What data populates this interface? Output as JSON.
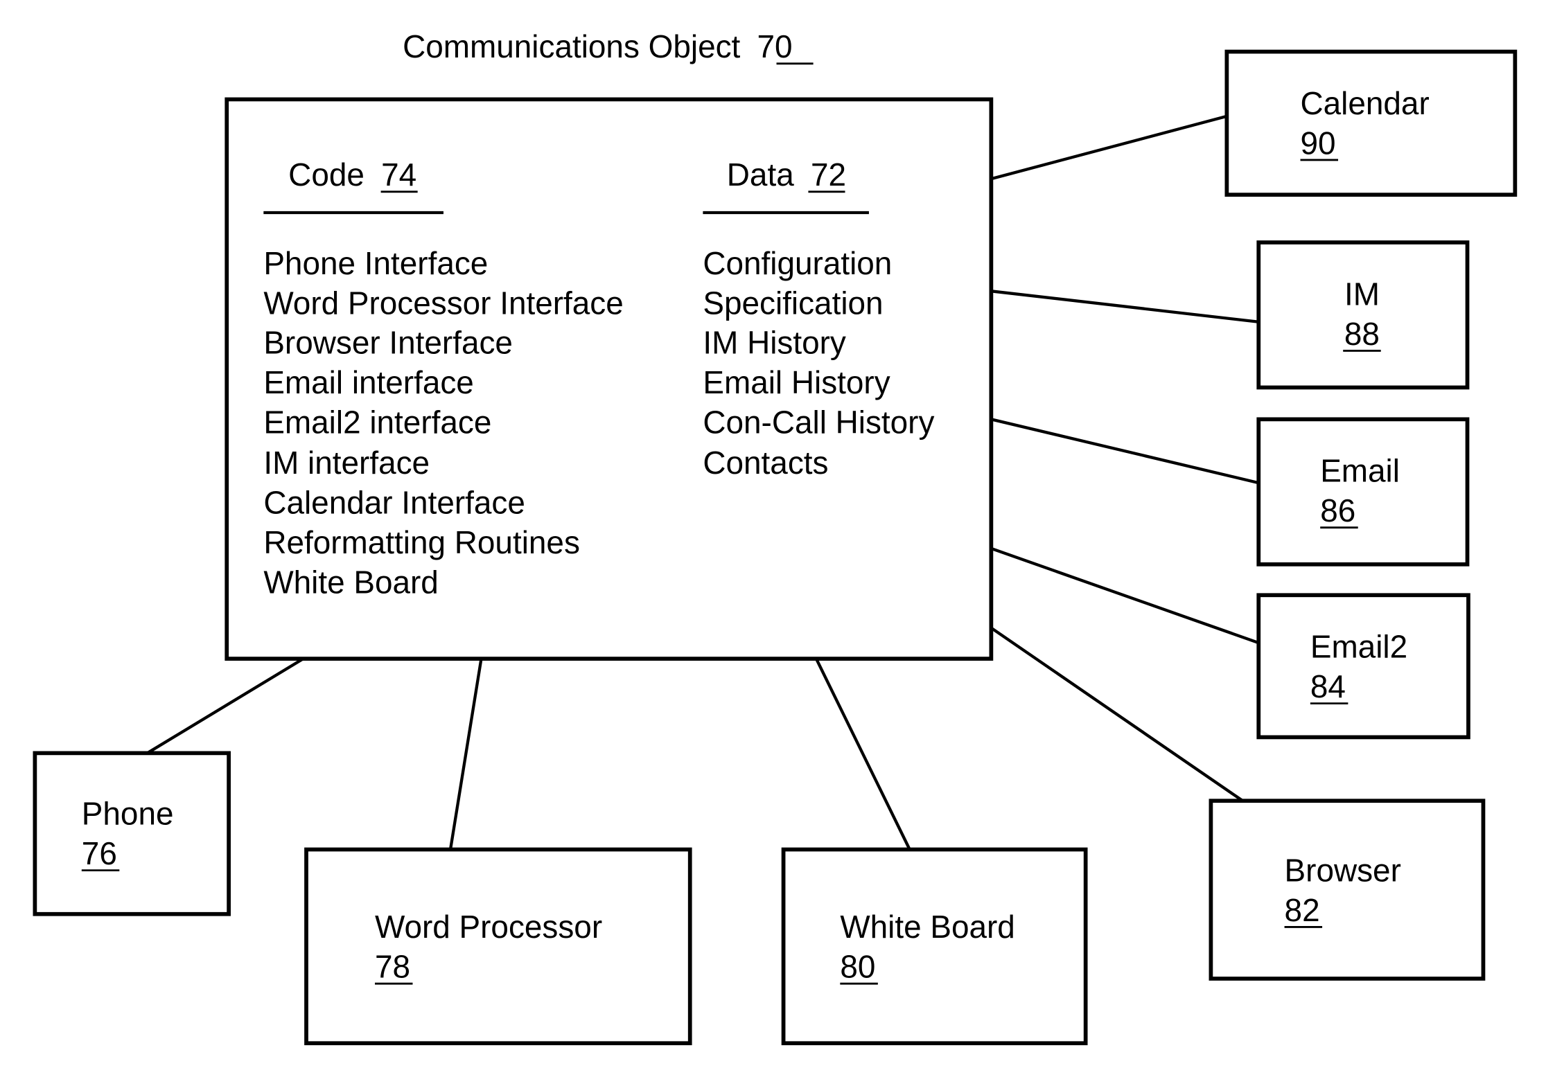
{
  "title": {
    "label": "Communications Object",
    "ref": "70"
  },
  "main_object": {
    "code": {
      "heading": "Code",
      "ref": "74",
      "items": [
        "Phone Interface",
        "Word Processor Interface",
        "Browser Interface",
        "Email interface",
        "Email2 interface",
        "IM interface",
        "Calendar Interface",
        "Reformatting Routines",
        "White Board"
      ]
    },
    "data": {
      "heading": "Data",
      "ref": "72",
      "items": [
        "Configuration",
        "Specification",
        "IM History",
        "Email History",
        "Con-Call History",
        "Contacts"
      ]
    }
  },
  "nodes": {
    "calendar": {
      "label": "Calendar",
      "ref": "90"
    },
    "im": {
      "label": "IM",
      "ref": "88"
    },
    "email": {
      "label": "Email",
      "ref": "86"
    },
    "email2": {
      "label": "Email2",
      "ref": "84"
    },
    "browser": {
      "label": "Browser",
      "ref": "82"
    },
    "white_board": {
      "label": "White Board",
      "ref": "80"
    },
    "word_processor": {
      "label": "Word Processor",
      "ref": "78"
    },
    "phone": {
      "label": "Phone",
      "ref": "76"
    }
  },
  "connections": [
    {
      "from": "communications-object",
      "to": "calendar"
    },
    {
      "from": "communications-object",
      "to": "im"
    },
    {
      "from": "communications-object",
      "to": "email"
    },
    {
      "from": "communications-object",
      "to": "email2"
    },
    {
      "from": "communications-object",
      "to": "browser"
    },
    {
      "from": "communications-object",
      "to": "white_board"
    },
    {
      "from": "communications-object",
      "to": "word_processor"
    },
    {
      "from": "communications-object",
      "to": "phone"
    }
  ]
}
